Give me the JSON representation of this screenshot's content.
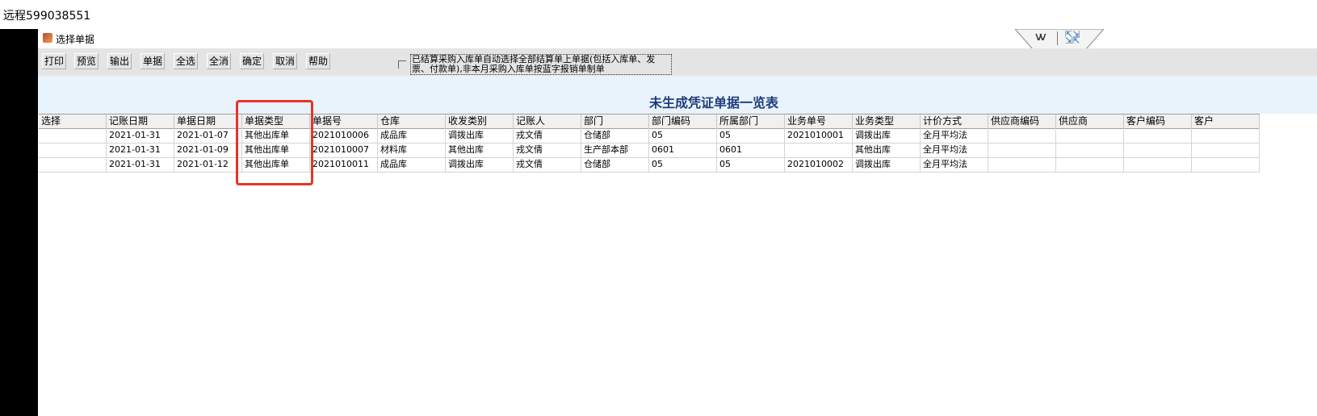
{
  "remote_label": "远程599038551",
  "window": {
    "title": "选择单据"
  },
  "toolbar": {
    "buttons": [
      "打印",
      "预览",
      "输出",
      "单据",
      "全选",
      "全消",
      "确定",
      "取消",
      "帮助"
    ],
    "note": "已结算采购入库单自动选择全部结算单上单据(包括入库单、发票、付款单),非本月采购入库单按蓝字报销单制单"
  },
  "list_title": "未生成凭证单据一览表",
  "table": {
    "columns": [
      "选择",
      "记账日期",
      "单据日期",
      "单据类型",
      "单据号",
      "仓库",
      "收发类别",
      "记账人",
      "部门",
      "部门编码",
      "所属部门",
      "业务单号",
      "业务类型",
      "计价方式",
      "供应商编码",
      "供应商",
      "客户编码",
      "客户"
    ],
    "rows": [
      [
        "",
        "2021-01-31",
        "2021-01-07",
        "其他出库单",
        "2021010006",
        "成品库",
        "调拨出库",
        "戎文倩",
        "仓储部",
        "05",
        "05",
        "2021010001",
        "调拨出库",
        "全月平均法",
        "",
        "",
        "",
        ""
      ],
      [
        "",
        "2021-01-31",
        "2021-01-09",
        "其他出库单",
        "2021010007",
        "材料库",
        "其他出库",
        "戎文倩",
        "生产部本部",
        "0601",
        "0601",
        "",
        "其他出库",
        "全月平均法",
        "",
        "",
        "",
        ""
      ],
      [
        "",
        "2021-01-31",
        "2021-01-12",
        "其他出库单",
        "2021010011",
        "成品库",
        "调拨出库",
        "戎文倩",
        "仓储部",
        "05",
        "05",
        "2021010002",
        "调拨出库",
        "全月平均法",
        "",
        "",
        "",
        ""
      ]
    ]
  },
  "icons": {
    "title": "app-icon",
    "collapse": "double-chevron-down-icon",
    "expand": "expand-arrows-icon"
  },
  "colors": {
    "band_bg": "#e8f3fc",
    "title_text": "#1f3d7a",
    "highlight": "#e8332a"
  }
}
